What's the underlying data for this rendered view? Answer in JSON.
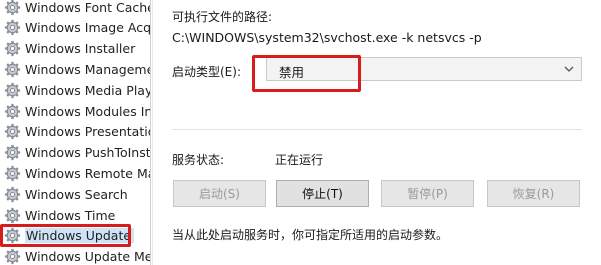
{
  "services": {
    "items": [
      {
        "label": "Windows Font Cache",
        "selected": false
      },
      {
        "label": "Windows Image Acqu",
        "selected": false
      },
      {
        "label": "Windows Installer",
        "selected": false
      },
      {
        "label": "Windows Manageme",
        "selected": false
      },
      {
        "label": "Windows Media Playe",
        "selected": false
      },
      {
        "label": "Windows Modules In",
        "selected": false
      },
      {
        "label": "Windows Presentatio",
        "selected": false
      },
      {
        "label": "Windows PushToInsta",
        "selected": false
      },
      {
        "label": "Windows Remote Ma",
        "selected": false
      },
      {
        "label": "Windows Search",
        "selected": false
      },
      {
        "label": "Windows Time",
        "selected": false
      },
      {
        "label": "Windows Update",
        "selected": true
      },
      {
        "label": "Windows Update Me",
        "selected": false
      }
    ],
    "icon": "gear-icon"
  },
  "properties": {
    "path_label": "可执行文件的路径:",
    "path_value": "C:\\WINDOWS\\system32\\svchost.exe -k netsvcs -p",
    "startup_type_label": "启动类型(E):",
    "startup_type_value": "禁用",
    "service_status_label": "服务状态:",
    "service_status_value": "正在运行",
    "buttons": {
      "start": "启动(S)",
      "stop": "停止(T)",
      "pause": "暂停(P)",
      "resume": "恢复(R)"
    },
    "hint": "当从此处启动服务时，你可指定所适用的启动参数。"
  },
  "colors": {
    "highlight_box": "#d71c1c",
    "selection": "#cfe3f7"
  }
}
